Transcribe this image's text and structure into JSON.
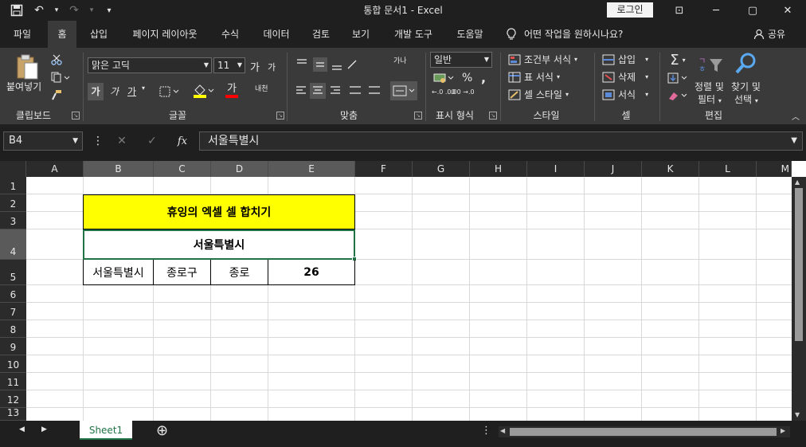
{
  "window": {
    "title": "통합 문서1  -  Excel",
    "login_label": "로그인",
    "minimize_icon": "─",
    "restore_icon": "▢",
    "close_icon": "✕",
    "ribbon_display_icon": "⊡"
  },
  "qat": {
    "save_icon": "💾",
    "undo_icon": "↶",
    "redo_icon": "↷",
    "customize_icon": "▾"
  },
  "tabs": [
    {
      "label": "파일"
    },
    {
      "label": "홈"
    },
    {
      "label": "삽입"
    },
    {
      "label": "페이지 레이아웃"
    },
    {
      "label": "수식"
    },
    {
      "label": "데이터"
    },
    {
      "label": "검토"
    },
    {
      "label": "보기"
    },
    {
      "label": "개발 도구"
    },
    {
      "label": "도움말"
    }
  ],
  "tellme": {
    "icon": "💡",
    "label": "어떤 작업을 원하시나요?"
  },
  "share": {
    "icon": "👤",
    "label": "공유"
  },
  "ribbon": {
    "clipboard": {
      "paste_label": "붙여넣기",
      "group_label": "클립보드"
    },
    "font": {
      "font_name": "맑은 고딕",
      "font_size": "11",
      "grow_label": "가",
      "shrink_label": "가",
      "bold_label": "가",
      "italic_label": "가",
      "underline_label": "가",
      "font_color_label": "가",
      "phonetic_label": "내천",
      "group_label": "글꼴"
    },
    "alignment": {
      "wrap_label": "가나",
      "group_label": "맞춤"
    },
    "number": {
      "format": "일반",
      "percent_label": "%",
      "comma_label": ",",
      "inc_label": "←.0 .00",
      "dec_label": ".00 →.0",
      "group_label": "표시 형식"
    },
    "styles": {
      "conditional_label": "조건부 서식",
      "table_label": "표 서식",
      "cell_style_label": "셀 스타일",
      "group_label": "스타일"
    },
    "cells": {
      "insert_label": "삽입",
      "delete_label": "삭제",
      "format_label": "서식",
      "group_label": "셀"
    },
    "editing": {
      "sort_label_1": "정렬 및",
      "sort_label_2": "필터",
      "find_label_1": "찾기 및",
      "find_label_2": "선택",
      "group_label": "편집"
    }
  },
  "formula_bar": {
    "name_box": "B4",
    "cancel_icon": "✕",
    "enter_icon": "✓",
    "fx_icon": "fx",
    "content": "서울특별시"
  },
  "grid": {
    "columns": [
      "A",
      "B",
      "C",
      "D",
      "E",
      "F",
      "G",
      "H",
      "I",
      "J",
      "K",
      "L",
      "M"
    ],
    "rows": [
      "1",
      "2",
      "3",
      "4",
      "5",
      "6",
      "7",
      "8",
      "9",
      "10",
      "11",
      "12",
      "13"
    ],
    "title_cell": "휴잉의 엑셀 셀 합치기",
    "merged_cell": "서울특별시",
    "row5": [
      "서울특별시",
      "종로구",
      "종로",
      "26"
    ],
    "title_fill": "#ffff00",
    "selection_color": "#217346"
  },
  "sheets": {
    "active": "Sheet1",
    "add_icon": "⊕",
    "prev_icon": "◀",
    "next_icon": "▶",
    "more_icon": "⋮"
  }
}
